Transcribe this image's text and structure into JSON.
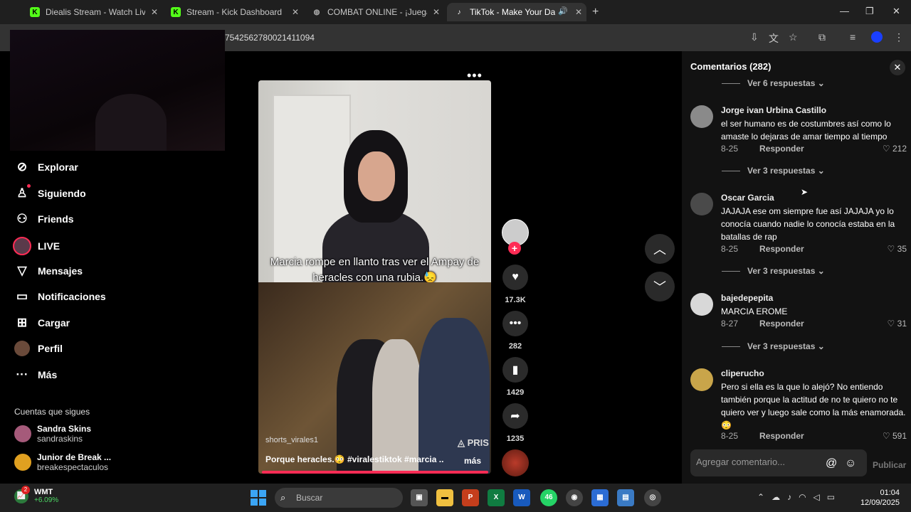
{
  "browser": {
    "tabs": [
      {
        "title": "Diealis Stream - Watch Live on K",
        "favicon": "kick-icon"
      },
      {
        "title": "Stream - Kick Dashboard",
        "favicon": "kick-icon"
      },
      {
        "title": "COMBAT ONLINE - ¡Juega Gratis",
        "favicon": "globe-icon"
      },
      {
        "title": "TikTok - Make Your Day",
        "favicon": "tiktok-icon"
      }
    ],
    "url": "7542562780021411094"
  },
  "sidebar": {
    "nav": [
      {
        "label": "Explorar",
        "icon": "compass-icon"
      },
      {
        "label": "Siguiendo",
        "icon": "following-icon"
      },
      {
        "label": "Friends",
        "icon": "friends-icon"
      },
      {
        "label": "LIVE",
        "icon": "live-icon"
      },
      {
        "label": "Mensajes",
        "icon": "messages-icon"
      },
      {
        "label": "Notificaciones",
        "icon": "notifications-icon"
      },
      {
        "label": "Cargar",
        "icon": "upload-icon"
      },
      {
        "label": "Perfil",
        "icon": "profile-icon"
      },
      {
        "label": "Más",
        "icon": "more-icon"
      }
    ],
    "following_header": "Cuentas que sigues",
    "accounts": [
      {
        "name": "Sandra Skins",
        "handle": "sandraskins"
      },
      {
        "name": "Junior de Break ...",
        "handle": "breakespectaculos"
      }
    ]
  },
  "video": {
    "caption": "Marcia rompe en llanto tras ver el Ampay de heracles con una rubia.😓",
    "watermark": "shorts_virales1",
    "overlay_brand": "PRIS",
    "description": "Porque heracles.😳 #viralestiktok #marcia ...",
    "more": "más"
  },
  "actions": {
    "likes": "17.3K",
    "comments": "282",
    "saves": "1429",
    "shares": "1235"
  },
  "comments_panel": {
    "title": "Comentarios (282)",
    "top_replies": "Ver 6 respuestas",
    "reply_label": "Responder",
    "items": [
      {
        "user": "Jorge ivan Urbina Castillo",
        "text": "el ser humano es de costumbres así como lo amaste lo dejaras de amar tiempo al tiempo",
        "date": "8-25",
        "likes": "212",
        "replies": "Ver 3 respuestas"
      },
      {
        "user": "Oscar Garcia",
        "text": "JAJAJA ese om siempre fue así JAJAJA yo lo conocía cuando nadie lo conocía estaba en la batallas de rap",
        "date": "8-25",
        "likes": "35",
        "replies": "Ver 3 respuestas"
      },
      {
        "user": "bajedepepita",
        "text": "MARCIA EROME",
        "date": "8-27",
        "likes": "31",
        "replies": "Ver 3 respuestas"
      },
      {
        "user": "cliperucho",
        "text": "Pero si ella es la que lo alejó? No entiendo también porque la actitud de no te quiero no te quiero ver y luego sale como la más enamorada. 😳",
        "date": "8-25",
        "likes": "591"
      }
    ],
    "input_placeholder": "Agregar comentario...",
    "post": "Publicar"
  },
  "taskbar": {
    "ticker": "WMT",
    "change": "+6.09%",
    "notif_count": "2",
    "search_placeholder": "Buscar",
    "whatsapp_badge": "46",
    "time": "01:04",
    "date": "12/09/2025"
  }
}
